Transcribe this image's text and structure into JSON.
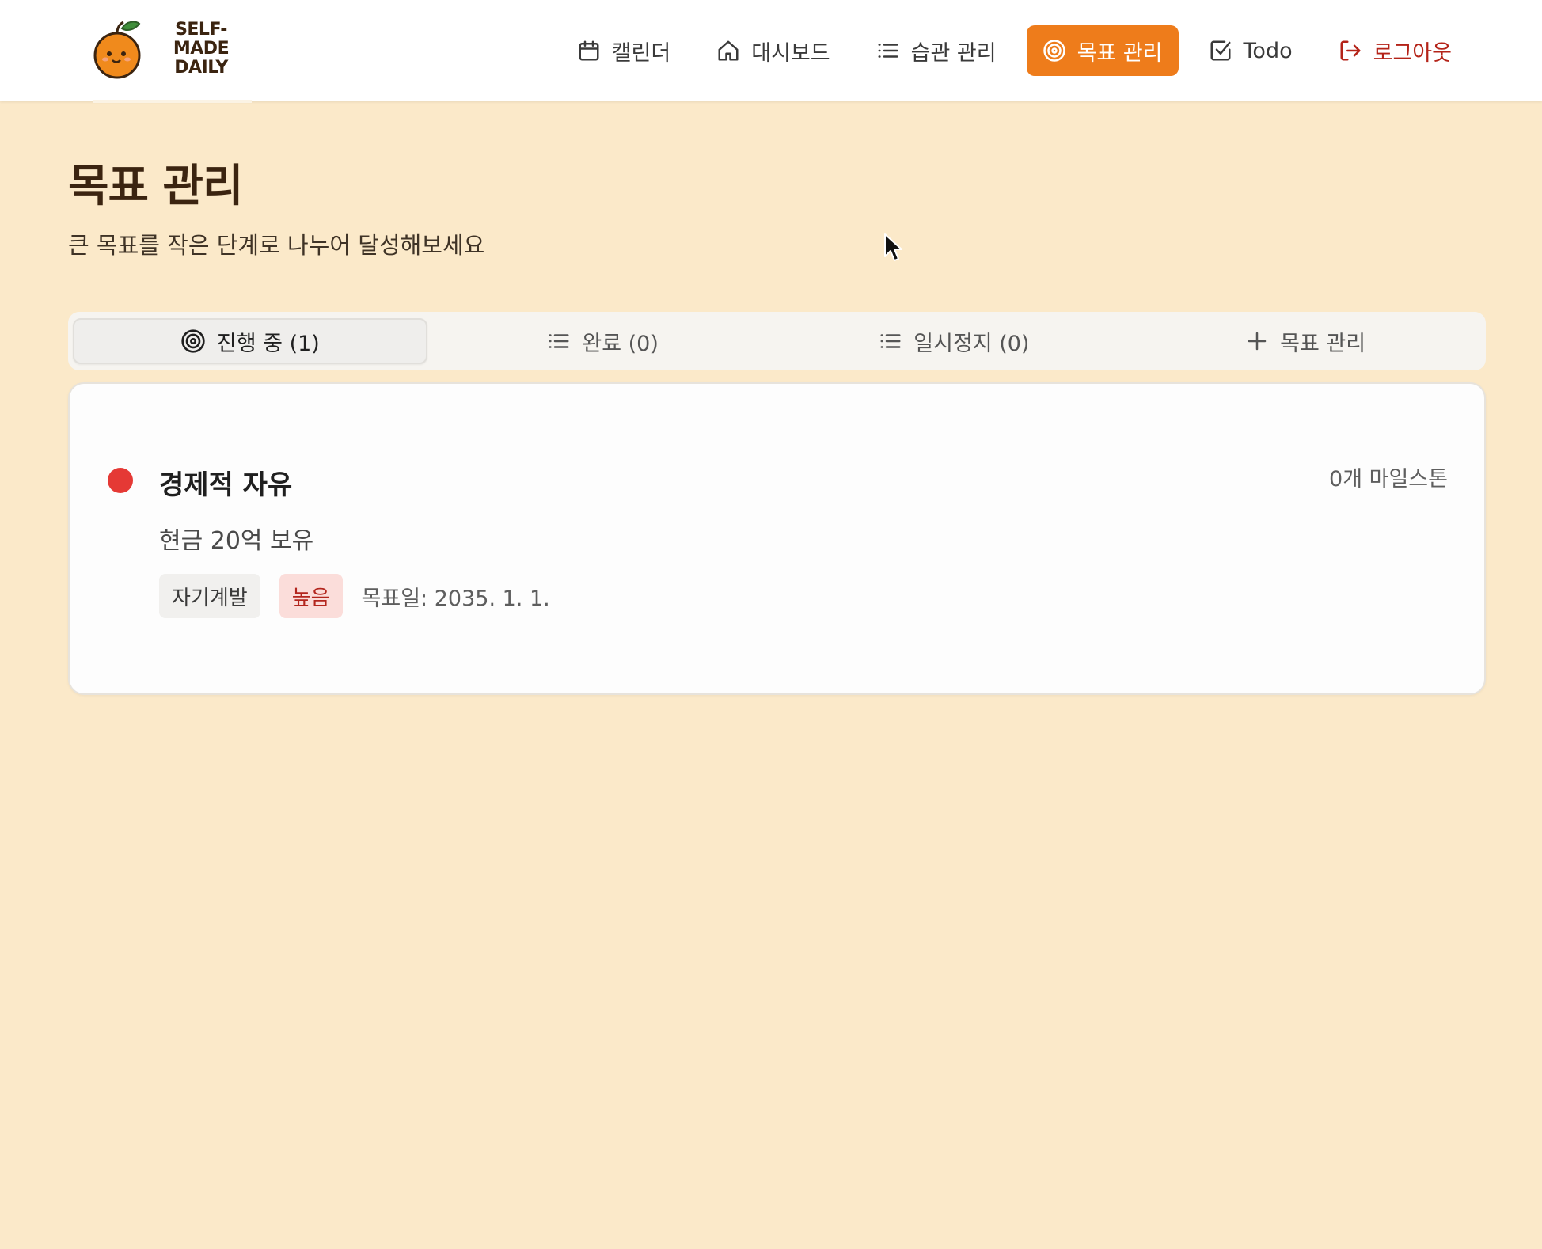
{
  "brand": {
    "line1": "SELF-MADE",
    "line2": "DAILY",
    "accent_color": "#EE7C1B"
  },
  "nav": [
    {
      "label": "캘린더",
      "icon": "calendar-icon"
    },
    {
      "label": "대시보드",
      "icon": "home-icon"
    },
    {
      "label": "습관 관리",
      "icon": "list-icon"
    },
    {
      "label": "목표 관리",
      "icon": "target-icon",
      "active": true
    },
    {
      "label": "Todo",
      "icon": "checkbox-icon"
    },
    {
      "label": "로그아웃",
      "icon": "logout-icon"
    }
  ],
  "page": {
    "title": "목표 관리",
    "subtitle": "큰 목표를 작은 단계로 나누어 달성해보세요"
  },
  "tabs": [
    {
      "label": "진행 중 (1)",
      "icon": "target-icon",
      "active": true
    },
    {
      "label": "완료 (0)",
      "icon": "list-icon"
    },
    {
      "label": "일시정지 (0)",
      "icon": "list-icon"
    },
    {
      "label": "목표 관리",
      "icon": "plus-icon"
    }
  ],
  "goal": {
    "title": "경제적 자유",
    "description": "현금 20억 보유",
    "milestones": "0개 마일스톤",
    "category": "자기계발",
    "priority": "높음",
    "date": "목표일: 2035. 1. 1.",
    "status_color": "#E53935"
  }
}
